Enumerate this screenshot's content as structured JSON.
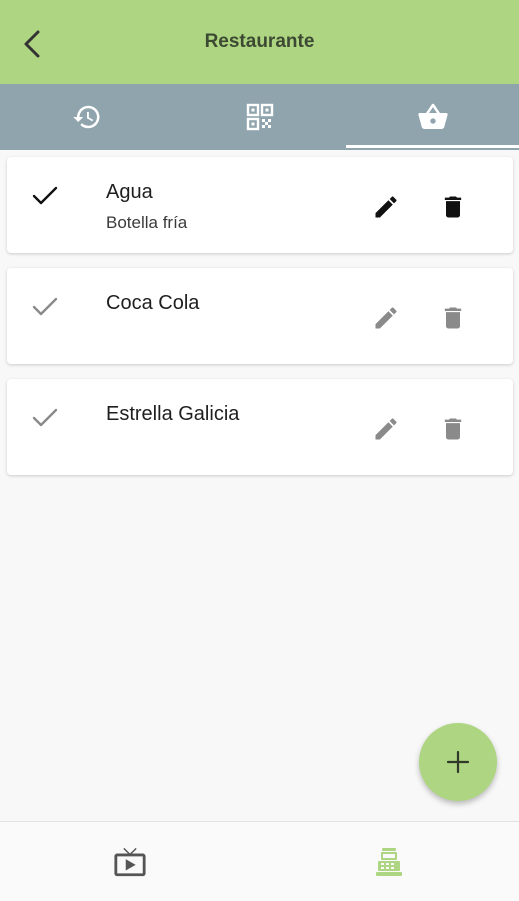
{
  "header": {
    "title": "Restaurante",
    "back_icon": "arrow-back-icon"
  },
  "tabs": [
    {
      "name": "history",
      "icon": "history-icon",
      "selected": false
    },
    {
      "name": "qr",
      "icon": "qr-code-icon",
      "selected": false
    },
    {
      "name": "basket",
      "icon": "shopping-basket-icon",
      "selected": true
    }
  ],
  "items": [
    {
      "name": "Agua",
      "subtitle": "Botella fría",
      "enabled": true
    },
    {
      "name": "Coca Cola",
      "subtitle": "",
      "enabled": false
    },
    {
      "name": "Estrella Galicia",
      "subtitle": "",
      "enabled": false
    }
  ],
  "fab": {
    "icon": "add-icon"
  },
  "bottom_nav": [
    {
      "name": "tv",
      "icon": "live-tv-icon",
      "selected": false
    },
    {
      "name": "register",
      "icon": "cash-register-icon",
      "selected": true
    }
  ],
  "colors": {
    "appbar": "#aed581",
    "tabbar": "#90a4ae",
    "accent": "#aed581",
    "active_icon": "#111111",
    "disabled_icon": "#8a8a8a"
  }
}
